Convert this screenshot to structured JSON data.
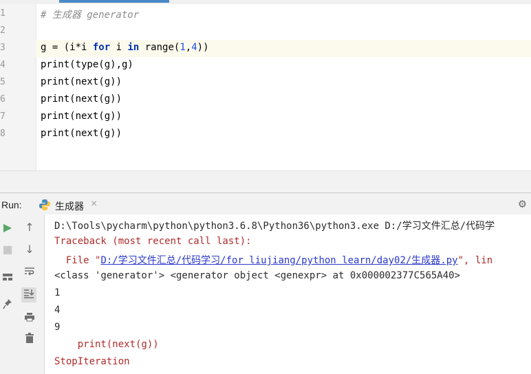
{
  "editor": {
    "line_numbers": [
      "1",
      "2",
      "3",
      "4",
      "5",
      "6",
      "7",
      "8"
    ],
    "comment": "# 生成器 generator",
    "line3": {
      "a": "g = (i*i ",
      "kw_for": "for",
      "b": " i ",
      "kw_in": "in",
      "c": " range(",
      "n1": "1",
      "comma": ",",
      "n2": "4",
      "d": "))"
    },
    "line4": "print(type(g),g)",
    "line5": "print(next(g))",
    "line6": "print(next(g))",
    "line7": "print(next(g))",
    "line8": "print(next(g))"
  },
  "run_panel": {
    "label": "Run:",
    "tab_label": "生成器",
    "tab_close": "×",
    "settings_icon": "gear-icon"
  },
  "toolbar": {
    "left": [
      {
        "icon": "play-icon",
        "glyph": "▶",
        "color": "#59a869"
      },
      {
        "icon": "stop-icon",
        "glyph": "■",
        "color": "#c9c9c9"
      },
      {
        "icon": "layout-icon",
        "glyph": "▬",
        "color": "#6e6e6e"
      },
      {
        "icon": "pin-icon",
        "glyph": "📌",
        "color": "#6e6e6e"
      }
    ],
    "mid": [
      {
        "icon": "arrow-up-icon",
        "glyph": "↑"
      },
      {
        "icon": "arrow-down-icon",
        "glyph": "↓"
      },
      {
        "icon": "soft-wrap-icon",
        "glyph": "↵"
      },
      {
        "icon": "scroll-to-end-icon",
        "glyph": "⇊"
      },
      {
        "icon": "print-icon",
        "glyph": "⎙"
      },
      {
        "icon": "trash-icon",
        "glyph": "🗑"
      }
    ]
  },
  "console": {
    "cmd": "D:\\Tools\\pycharm\\python\\python3.6.8\\Python36\\python3.exe D:/学习文件汇总/代码学",
    "traceback": "Traceback (most recent call last):",
    "file_prefix": "  File \"",
    "file_link": "D:/学习文件汇总/代码学习/for liujiang/python learn/day02/生成器.py",
    "file_suffix": "\", lin",
    "type_line": "<class 'generator'> <generator object <genexpr> at 0x000002377C565A40>",
    "out1": "1",
    "out2": "4",
    "out3": "9",
    "err_code": "    print(next(g))",
    "err_name": "StopIteration"
  },
  "colors": {
    "keyword": "#0033b3",
    "number": "#1750eb",
    "comment": "#8c8c8c",
    "error": "#b02a2a",
    "link": "#2a39c7"
  }
}
